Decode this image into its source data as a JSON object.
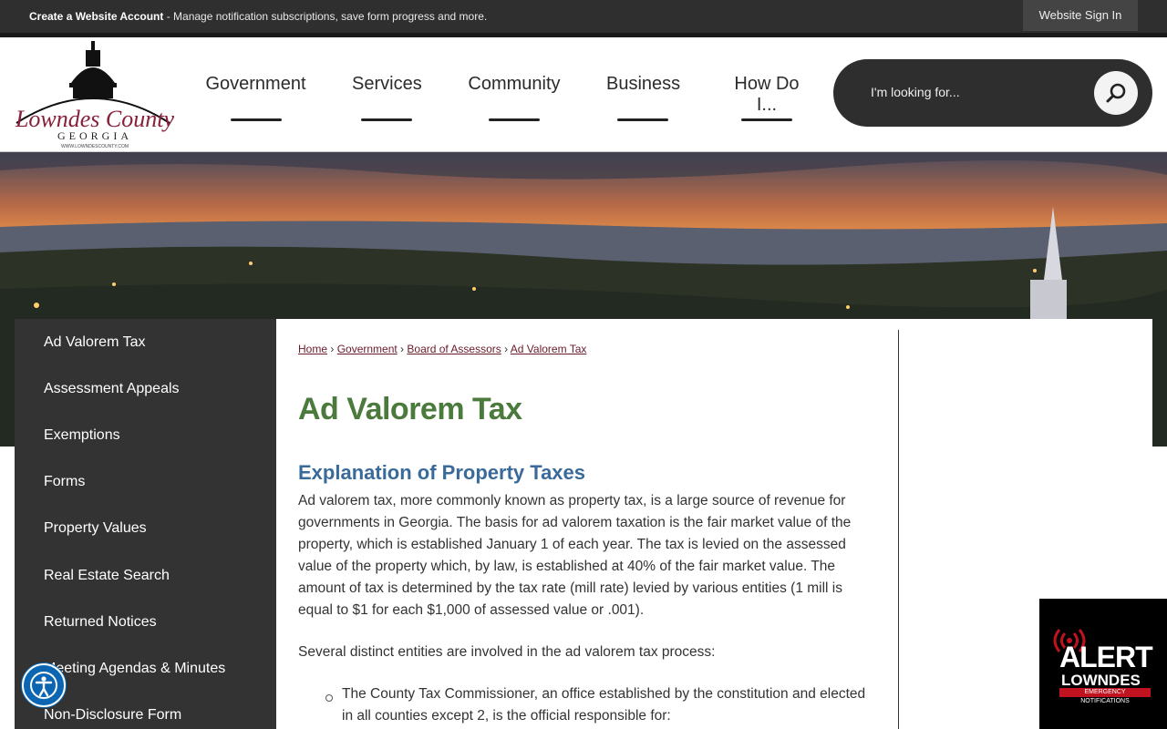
{
  "topbar": {
    "account_link": "Create a Website Account",
    "account_text": " - Manage notification subscriptions, save form progress and more.",
    "signin": "Website Sign In"
  },
  "logo": {
    "line1": "Lowndes County",
    "line2": "GEORGIA",
    "line3": "WWW.LOWNDESCOUNTY.COM"
  },
  "nav": [
    "Government",
    "Services",
    "Community",
    "Business",
    "How Do I..."
  ],
  "search": {
    "placeholder": "I'm looking for..."
  },
  "sidebar": {
    "items": [
      "Ad Valorem Tax",
      "Assessment Appeals",
      "Exemptions",
      "Forms",
      "Property Values",
      "Real Estate Search",
      "Returned Notices",
      "Meeting Agendas & Minutes",
      "Non-Disclosure Form"
    ]
  },
  "breadcrumb": [
    "Home",
    "Government",
    "Board of Assessors",
    "Ad Valorem Tax"
  ],
  "page": {
    "title": "Ad Valorem Tax",
    "subtitle": "Explanation of Property Taxes",
    "para1": "Ad valorem tax, more commonly known as property tax, is a large source of revenue for governments in Georgia. The basis for ad valorem taxation is the fair market value of the property, which is established January 1 of each year. The tax is levied on the assessed value of the property which, by law, is established at 40% of the fair market value. The amount of tax is determined by the tax rate (mill rate) levied by various entities (1 mill is equal to $1 for each $1,000 of assessed value or .001).",
    "para2": "Several distinct entities are involved in the ad valorem tax process:",
    "bullet1": "The County Tax Commissioner, an office established by the constitution and elected in all counties except 2, is the official responsible for:"
  },
  "alert": {
    "line1": "ALERT",
    "line2": "LOWNDES",
    "line3": "EMERGENCY NOTIFICATIONS"
  }
}
